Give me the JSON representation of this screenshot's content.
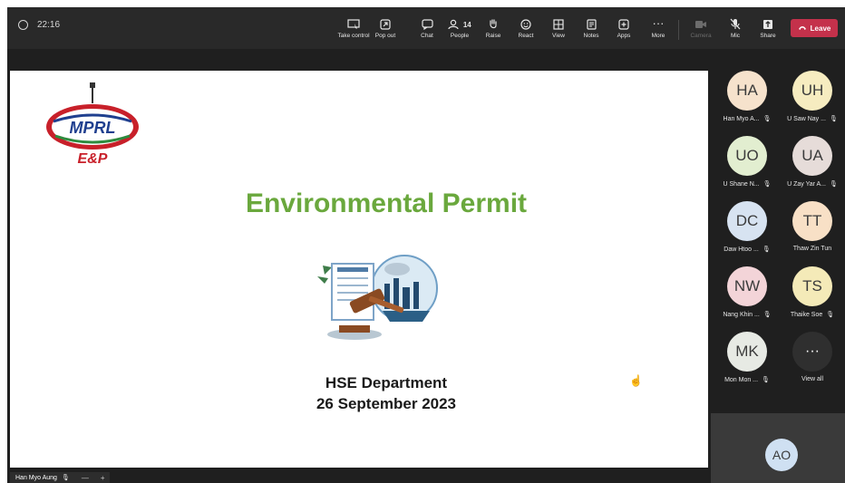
{
  "colors": {
    "leave_red": "#c4314b",
    "title_green": "#6aa83d",
    "mprl_red": "#c8202a",
    "mprl_blue": "#1f3f8f"
  },
  "meeting": {
    "time": "22:16"
  },
  "toolbar": {
    "items": [
      {
        "label": "Take control",
        "icon": "take-control-icon"
      },
      {
        "label": "Pop out",
        "icon": "pop-out-icon"
      },
      {
        "label": "Chat",
        "icon": "chat-icon"
      },
      {
        "label": "People",
        "icon": "people-icon",
        "count": "14"
      },
      {
        "label": "Raise",
        "icon": "raise-hand-icon"
      },
      {
        "label": "React",
        "icon": "react-icon"
      },
      {
        "label": "View",
        "icon": "view-icon"
      },
      {
        "label": "Notes",
        "icon": "notes-icon"
      },
      {
        "label": "Apps",
        "icon": "apps-icon"
      },
      {
        "label": "More",
        "icon": "more-icon"
      },
      {
        "label": "Camera",
        "icon": "camera-icon"
      },
      {
        "label": "Mic",
        "icon": "mic-off-icon"
      },
      {
        "label": "Share",
        "icon": "share-icon"
      }
    ],
    "leave_label": "Leave"
  },
  "slide": {
    "logo_text": "MPRL",
    "logo_subtext": "E&P",
    "title": "Environmental Permit",
    "department": "HSE Department",
    "date": "26 September 2023"
  },
  "participants": [
    {
      "initials": "HA",
      "name": "Han Myo A...",
      "color": "#f6e2cc"
    },
    {
      "initials": "UH",
      "name": "U Saw Nay ...",
      "color": "#f6ecc0"
    },
    {
      "initials": "UO",
      "name": "U Shane N...",
      "color": "#e2eed0"
    },
    {
      "initials": "UA",
      "name": "U Zay Yar A...",
      "color": "#e6dcd9"
    },
    {
      "initials": "DC",
      "name": "Daw Htoo ...",
      "color": "#d7e3f1"
    },
    {
      "initials": "TT",
      "name": "Thaw Zin Tun",
      "color": "#f8e0c6"
    },
    {
      "initials": "NW",
      "name": "Nang Khin ...",
      "color": "#f3d4d8"
    },
    {
      "initials": "TS",
      "name": "Thaike Soe",
      "color": "#f4eab8"
    },
    {
      "initials": "MK",
      "name": "Mon Mon ...",
      "color": "#e7eae4"
    }
  ],
  "view_all": {
    "icon_text": "···",
    "label": "View all"
  },
  "self_view": {
    "initials": "AO"
  },
  "presenter": {
    "name": "Han Myo Aung",
    "zoom_out": "—",
    "zoom_in": "+"
  }
}
